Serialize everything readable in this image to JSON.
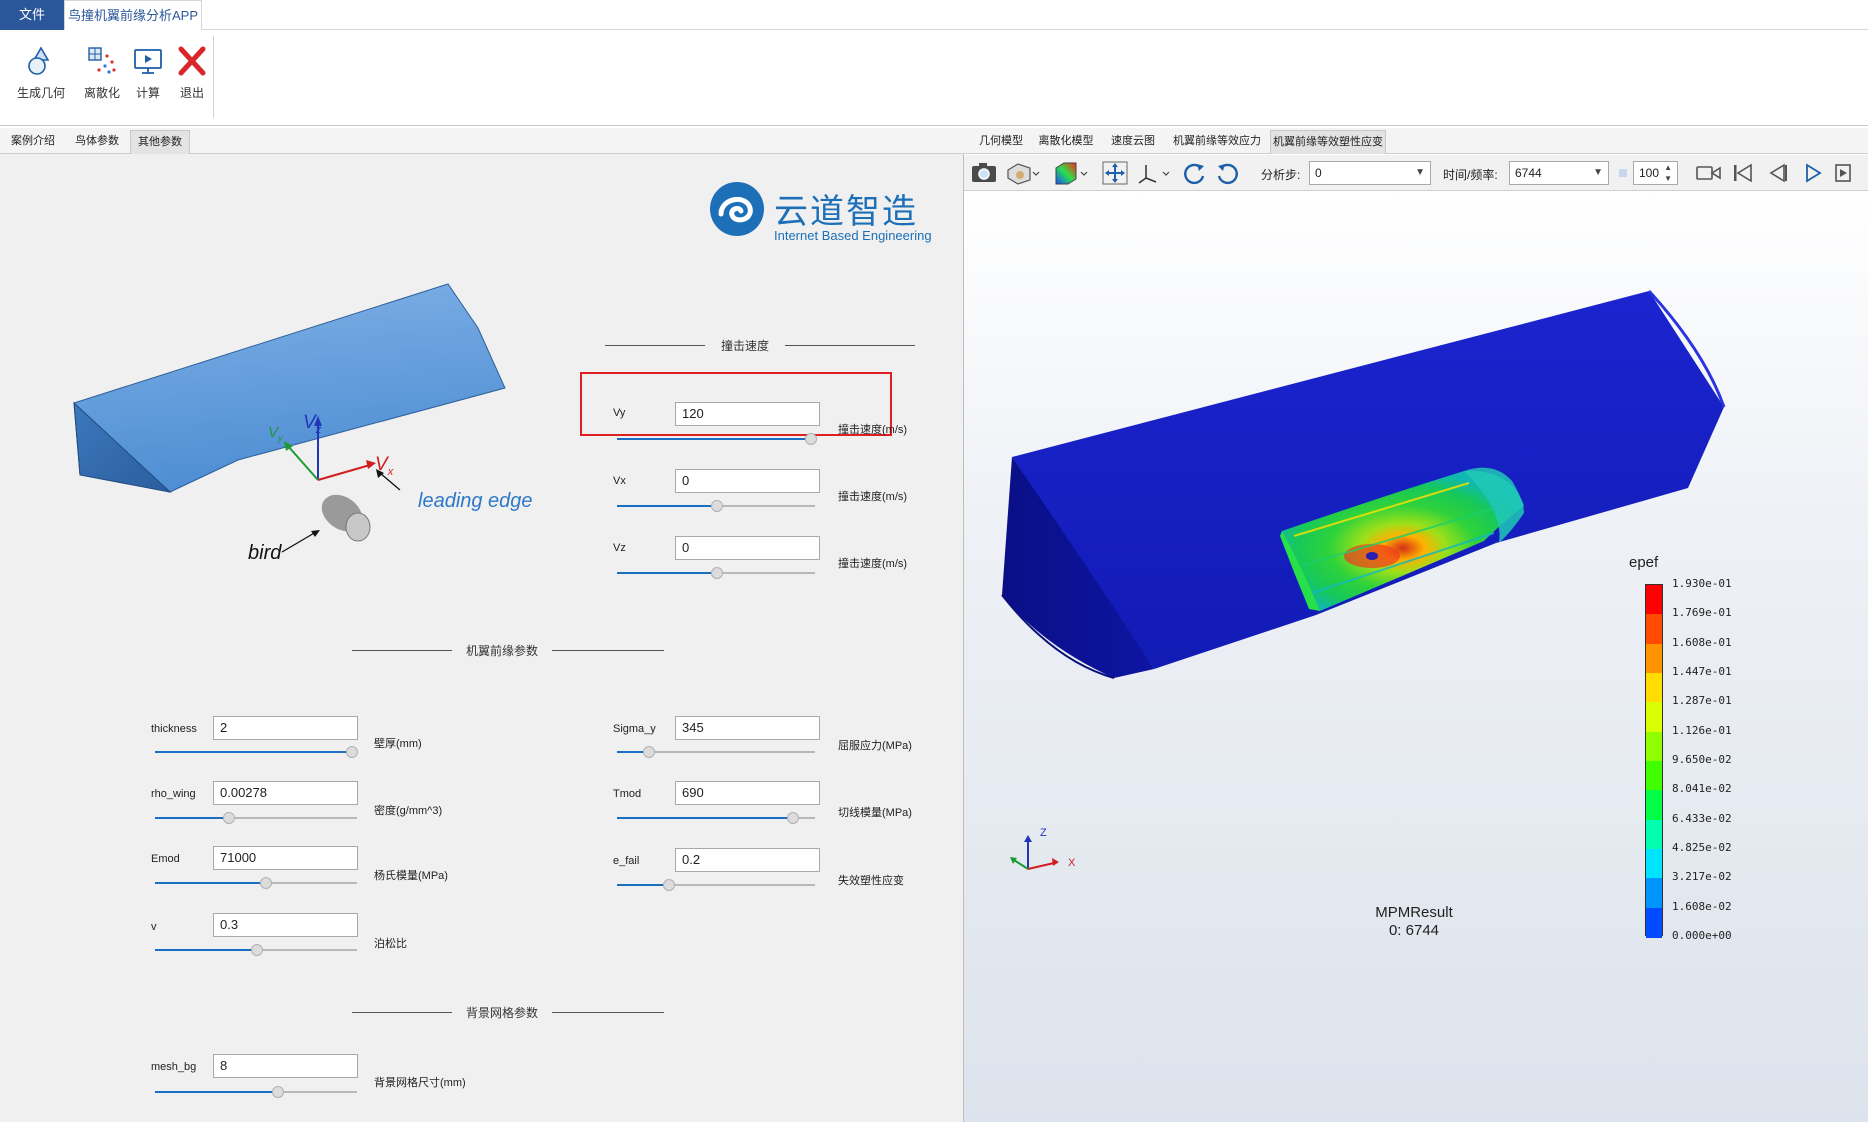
{
  "menu": {
    "file_tab": "文件",
    "app_tab": "鸟撞机翼前缘分析APP"
  },
  "ribbon": {
    "buttons": [
      {
        "label": "生成几何",
        "icon": "geometry-icon"
      },
      {
        "label": "离散化",
        "icon": "mesh-icon"
      },
      {
        "label": "计算",
        "icon": "compute-icon"
      },
      {
        "label": "退出",
        "icon": "exit-icon"
      }
    ]
  },
  "left_tabs": [
    "案例介绍",
    "鸟体参数",
    "其他参数"
  ],
  "left_active_tab": "其他参数",
  "logo": {
    "title": "云道智造",
    "subtitle": "Internet Based Engineering"
  },
  "diagram": {
    "leading_edge": "leading edge",
    "bird": "bird",
    "vz": "V",
    "vz_sub": "z",
    "vx": "V",
    "vx_sub": "x",
    "vy": "V",
    "vy_sub": "y"
  },
  "impact_section": {
    "title": "撞击速度",
    "fields": [
      {
        "label": "Vy",
        "value": "120",
        "unit": "撞击速度(m/s)",
        "slider": 1.0
      },
      {
        "label": "Vx",
        "value": "0",
        "unit": "撞击速度(m/s)",
        "slider": 0.5
      },
      {
        "label": "Vz",
        "value": "0",
        "unit": "撞击速度(m/s)",
        "slider": 0.5
      }
    ]
  },
  "wing_section": {
    "title": "机翼前缘参数",
    "left_fields": [
      {
        "label": "thickness",
        "value": "2",
        "unit": "壁厚(mm)",
        "slider": 1.0
      },
      {
        "label": "rho_wing",
        "value": "0.00278",
        "unit": "密度(g/mm^3)",
        "slider": 0.36
      },
      {
        "label": "Emod",
        "value": "71000",
        "unit": "杨氏模量(MPa)",
        "slider": 0.55
      },
      {
        "label": "v",
        "value": "0.3",
        "unit": "泊松比",
        "slider": 0.5
      }
    ],
    "right_fields": [
      {
        "label": "Sigma_y",
        "value": "345",
        "unit": "屈服应力(MPa)",
        "slider": 0.14
      },
      {
        "label": "Tmod",
        "value": "690",
        "unit": "切线模量(MPa)",
        "slider": 0.88
      },
      {
        "label": "e_fail",
        "value": "0.2",
        "unit": "失效塑性应变",
        "slider": 0.25
      }
    ]
  },
  "mesh_section": {
    "title": "背景网格参数",
    "fields": [
      {
        "label": "mesh_bg",
        "value": "8",
        "unit": "背景网格尺寸(mm)",
        "slider": 0.6
      }
    ]
  },
  "right_tabs": [
    "几何模型",
    "离散化模型",
    "速度云图",
    "机翼前缘等效应力",
    "机翼前缘等效塑性应变"
  ],
  "right_active_tab": "机翼前缘等效塑性应变",
  "toolbar": {
    "step_label": "分析步:",
    "step_value": "0",
    "time_label": "时间/频率:",
    "time_value": "6744",
    "frame_value": "100",
    "icons": [
      "camera-icon",
      "display-mode-icon",
      "color-map-icon",
      "fit-view-icon",
      "axes-icon",
      "rotate-cw-icon",
      "rotate-ccw-icon",
      "record-icon",
      "first-frame-icon",
      "prev-frame-icon",
      "play-icon",
      "next-icon"
    ]
  },
  "legend": {
    "title": "epef",
    "labels": [
      "1.930e-01",
      "1.769e-01",
      "1.608e-01",
      "1.447e-01",
      "1.287e-01",
      "1.126e-01",
      "9.650e-02",
      "8.041e-02",
      "6.433e-02",
      "4.825e-02",
      "3.217e-02",
      "1.608e-02",
      "0.000e+00"
    ],
    "colors": [
      "#ff0000",
      "#ff4a00",
      "#ff9400",
      "#ffdd00",
      "#d9ff00",
      "#8fff00",
      "#3fff00",
      "#00ff46",
      "#00ffb0",
      "#00e4ff",
      "#0094ff",
      "#004aff",
      "#0000ff"
    ]
  },
  "result": {
    "name": "MPMResult",
    "frame": "0: 6744"
  },
  "triad": {
    "z": "Z",
    "x": "X"
  }
}
